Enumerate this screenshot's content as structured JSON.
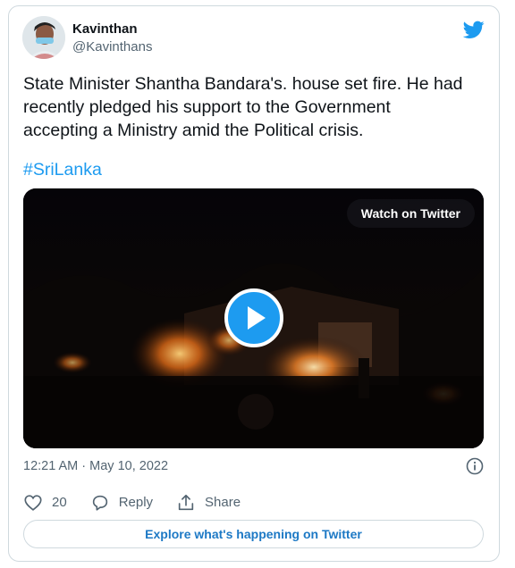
{
  "author": {
    "name": "Kavinthan",
    "handle": "@Kavinthans"
  },
  "tweet": {
    "text": "State Minister Shantha Bandara's. house set fire. He had\nrecently pledged his support to the Government\naccepting a Ministry amid the Political crisis.",
    "hashtag": "#SriLanka"
  },
  "media": {
    "watch_label": "Watch on Twitter"
  },
  "meta": {
    "timestamp": "12:21 AM · May 10, 2022"
  },
  "actions": {
    "like_count": "20",
    "reply_label": "Reply",
    "share_label": "Share"
  },
  "footer": {
    "explore_label": "Explore what's happening on Twitter"
  },
  "colors": {
    "accent": "#1d9bf0",
    "link": "#1d79c5",
    "muted": "#536471"
  }
}
